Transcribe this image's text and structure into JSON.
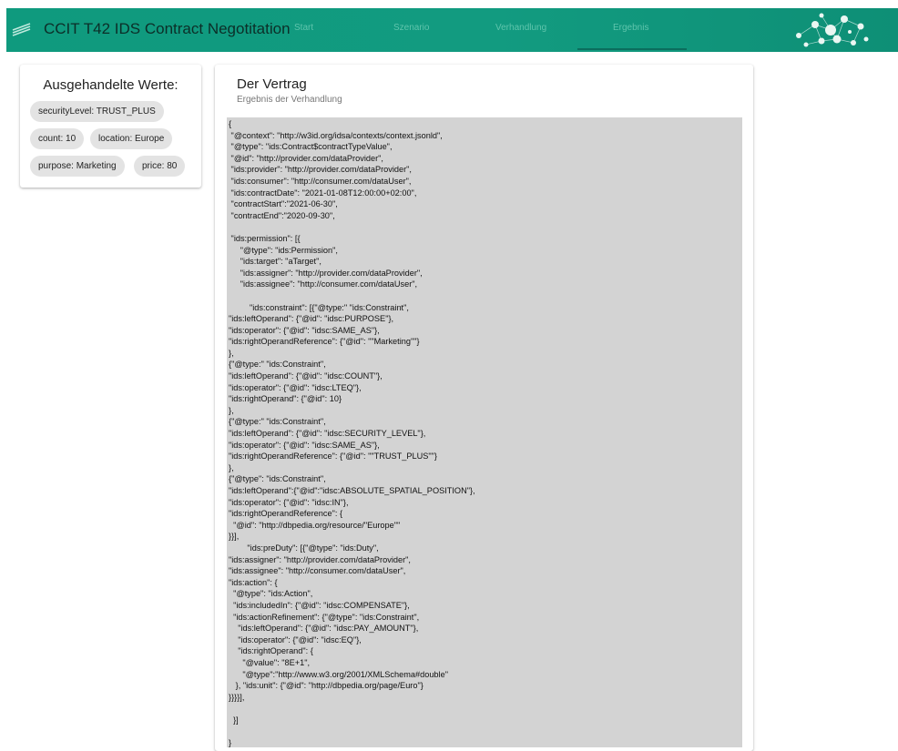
{
  "header": {
    "title": "CCIT T42 IDS Contract Negotitation",
    "nav": [
      {
        "label": "Start"
      },
      {
        "label": "Szenario"
      },
      {
        "label": "Verhandlung"
      },
      {
        "label": "Ergebnis",
        "active": true
      }
    ],
    "accent_color": "#129b80",
    "logo_icon": "stripes-logo-icon",
    "graphic_icon": "network-graphic"
  },
  "negotiated": {
    "title": "Ausgehandelte Werte:",
    "chips": [
      {
        "label": "securityLevel: TRUST_PLUS"
      },
      {
        "label": "count: 10"
      },
      {
        "label": "location: Europe"
      },
      {
        "label": "purpose: Marketing"
      },
      {
        "label": "price: 80"
      }
    ]
  },
  "contract": {
    "title": "Der Vertrag",
    "subtitle": "Ergebnis der Verhandlung",
    "text": "{\n \"@context\": \"http://w3id.org/idsa/contexts/context.jsonld\",\n \"@type\": \"ids:Contract$contractTypeValue\",\n \"@id\": \"http://provider.com/dataProvider\",\n \"ids:provider\": \"http://provider.com/dataProvider\",\n \"ids:consumer\": \"http://consumer.com/dataUser\",\n \"ids:contractDate\": \"2021-01-08T12:00:00+02:00\",\n \"contractStart\":\"2021-06-30\",\n \"contractEnd\":\"2020-09-30\",\n\n \"ids:permission\": [{\n     \"@type\": \"ids:Permission\",\n     \"ids:target\": \"aTarget\",\n     \"ids:assigner\": \"http://provider.com/dataProvider\",\n     \"ids:assignee\": \"http://consumer.com/dataUser\",\n\n         \"ids:constraint\": [{\"@type:\" \"ids:Constraint\",\n\"ids:leftOperand\": {\"@id\": \"idsc:PURPOSE\"},\n\"ids:operator\": {\"@id\": \"idsc:SAME_AS\"},\n\"ids:rightOperandReference\": {\"@id\": \"\"Marketing\"\"}\n},\n{\"@type:\" \"ids:Constraint\",\n\"ids:leftOperand\": {\"@id\": \"idsc:COUNT\"},\n\"ids:operator\": {\"@id\": \"idsc:LTEQ\"},\n\"ids:rightOperand\": {\"@id\": 10}\n},\n{\"@type:\" \"ids:Constraint\",\n\"ids:leftOperand\": {\"@id\": \"idsc:SECURITY_LEVEL\"},\n\"ids:operator\": {\"@id\": \"idsc:SAME_AS\"},\n\"ids:rightOperandReference\": {\"@id\": \"\"TRUST_PLUS\"\"}\n},\n{\"@type\": \"ids:Constraint\",\n\"ids:leftOperand\":{\"@id\":\"idsc:ABSOLUTE_SPATIAL_POSITION\"},\n\"ids:operator\": {\"@id\": \"idsc:IN\"},\n\"ids:rightOperandReference\": {\n  \"@id\": \"http://dbpedia.org/resource/\"Europe\"\"\n}}],\n        \"ids:preDuty\": [{\"@type\": \"ids:Duty\",\n\"ids:assigner\": \"http://provider.com/dataProvider\",\n\"ids:assignee\": \"http://consumer.com/dataUser\",\n\"ids:action\": {\n  \"@type\": \"ids:Action\",\n  \"ids:includedIn\": {\"@id\": \"idsc:COMPENSATE\"},\n  \"ids:actionRefinement\": {\"@type\": \"ids:Constraint\",\n    \"ids:leftOperand\": {\"@id\": \"idsc:PAY_AMOUNT\"},\n    \"ids:operator\": {\"@id\": \"idsc:EQ\"},\n    \"ids:rightOperand\": {\n      \"@value\": \"8E+1\",\n      \"@type\":\"http://www.w3.org/2001/XMLSchema#double\"\n   }, \"ids:unit\": {\"@id\": \"http://dbpedia.org/page/Euro\"}\n}}}}],\n\n  }]\n\n}"
  }
}
